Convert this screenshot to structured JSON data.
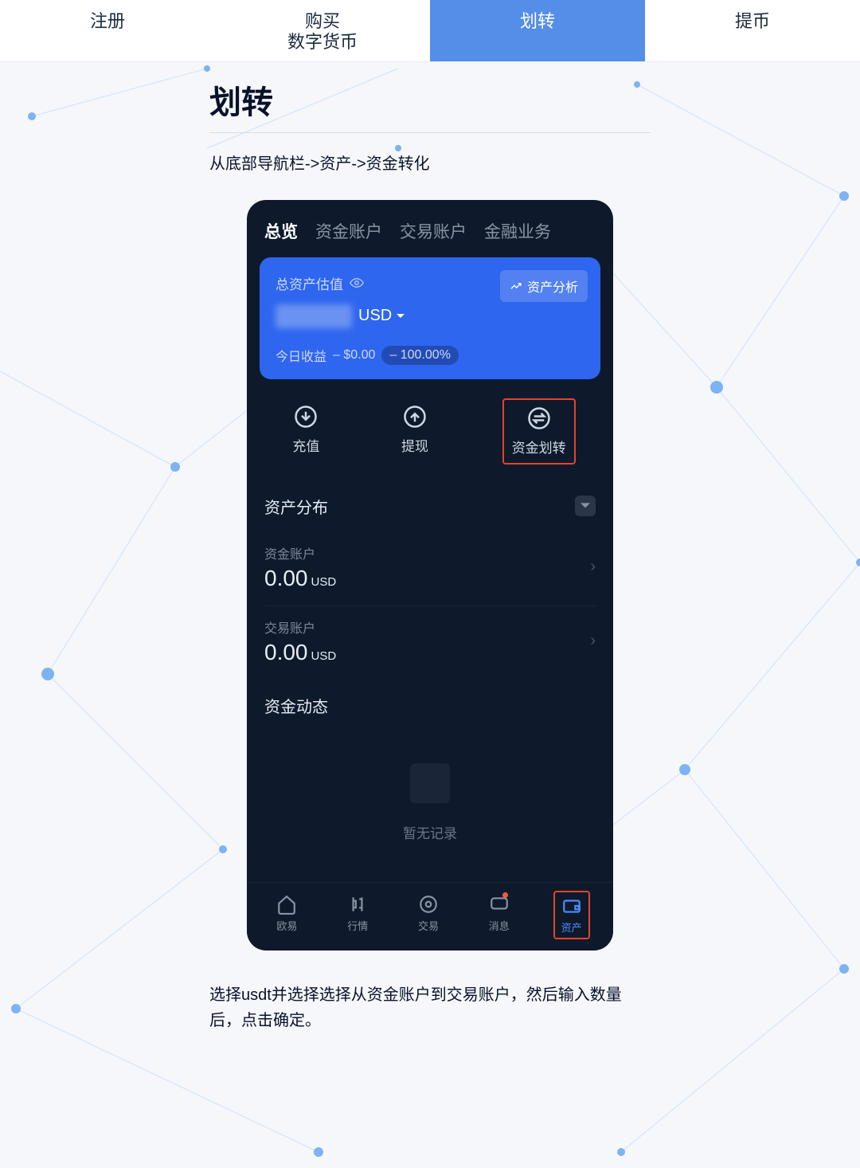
{
  "top_tabs": [
    {
      "line1": "注册",
      "line2": ""
    },
    {
      "line1": "购买",
      "line2": "数字货币"
    },
    {
      "line1": "划转",
      "line2": ""
    },
    {
      "line1": "提币",
      "line2": ""
    }
  ],
  "active_top_tab": 2,
  "page_title": "划转",
  "breadcrumb_desc": "从底部导航栏->资产->资金转化",
  "phone": {
    "tabs": [
      "总览",
      "资金账户",
      "交易账户",
      "金融业务"
    ],
    "active_tab": 0,
    "asset_card": {
      "label": "总资产估值",
      "analysis_btn": "资产分析",
      "currency": "USD",
      "today_label": "今日收益",
      "today_value": "– $0.00",
      "today_pct": "– 100.00%"
    },
    "actions": [
      {
        "label": "充值",
        "icon": "download-icon"
      },
      {
        "label": "提现",
        "icon": "upload-icon"
      },
      {
        "label": "资金划转",
        "icon": "transfer-icon",
        "highlight": true
      }
    ],
    "distribution_title": "资产分布",
    "accounts": [
      {
        "label": "资金账户",
        "value": "0.00",
        "unit": "USD"
      },
      {
        "label": "交易账户",
        "value": "0.00",
        "unit": "USD"
      }
    ],
    "activity_title": "资金动态",
    "empty_text": "暂无记录",
    "bottom_nav": [
      {
        "label": "欧易",
        "icon": "home-icon"
      },
      {
        "label": "行情",
        "icon": "market-icon"
      },
      {
        "label": "交易",
        "icon": "trade-icon"
      },
      {
        "label": "消息",
        "icon": "message-icon",
        "dot": true
      },
      {
        "label": "资产",
        "icon": "wallet-icon",
        "active": true
      }
    ]
  },
  "footer_desc": "选择usdt并选择选择从资金账户到交易账户，然后输入数量后，点击确定。"
}
